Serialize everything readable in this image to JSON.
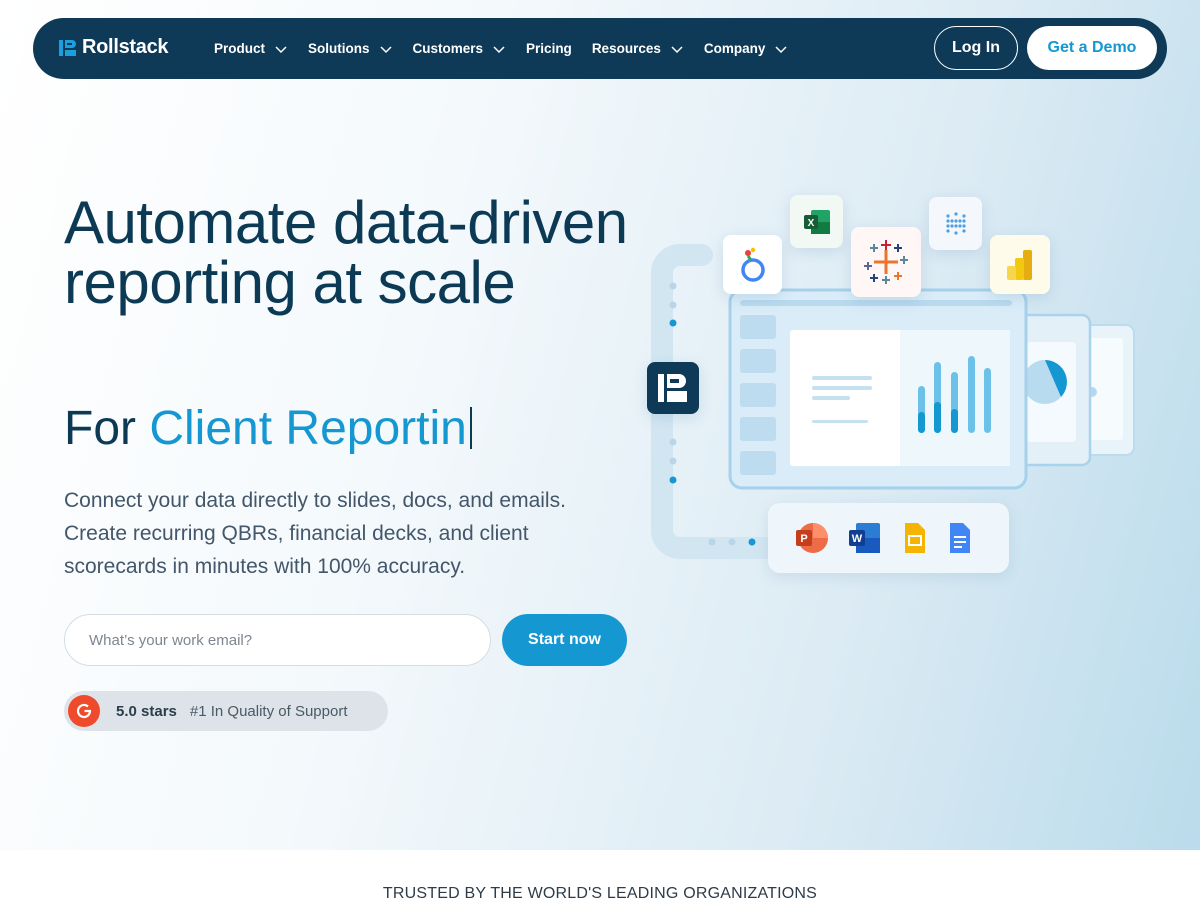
{
  "nav": {
    "logo_text": "Rollstack",
    "items": [
      {
        "label": "Product",
        "dropdown": true
      },
      {
        "label": "Solutions",
        "dropdown": true
      },
      {
        "label": "Customers",
        "dropdown": true
      },
      {
        "label": "Pricing",
        "dropdown": false
      },
      {
        "label": "Resources",
        "dropdown": true
      },
      {
        "label": "Company",
        "dropdown": true
      }
    ],
    "login_label": "Log In",
    "demo_label": "Get a Demo"
  },
  "hero": {
    "title": "Automate data-driven reporting at scale",
    "sub_prefix": "For ",
    "sub_accent": "Client Reportin",
    "description": "Connect your data directly to slides, docs, and emails. Create recurring QBRs, financial decks, and client scorecards in minutes with 100% accuracy.",
    "email_placeholder": "What’s your work email?",
    "start_label": "Start now"
  },
  "rating": {
    "badge": "G2",
    "stars": "5.0 stars",
    "quality": "#1 In Quality of Support"
  },
  "trusted": "TRUSTED BY THE WORLD'S LEADING ORGANIZATIONS",
  "colors": {
    "navy": "#0e3a57",
    "accent": "#1597d2",
    "g2": "#ef4a2b"
  },
  "icons": {
    "sources": [
      "looker-studio-icon",
      "excel-icon",
      "tableau-icon",
      "metabase-icon",
      "power-bi-icon"
    ],
    "destinations": [
      "powerpoint-icon",
      "word-icon",
      "google-slides-icon",
      "google-docs-icon"
    ]
  }
}
